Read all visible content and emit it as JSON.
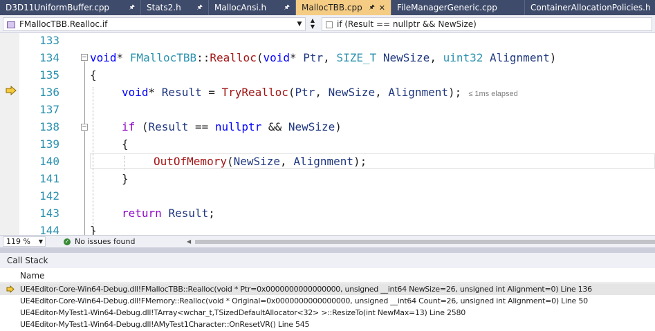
{
  "tabs": [
    {
      "label": "D3D11UniformBuffer.cpp",
      "pinned": true
    },
    {
      "label": "Stats2.h",
      "pinned": true
    },
    {
      "label": "MallocAnsi.h",
      "pinned": true
    },
    {
      "label": "MallocTBB.cpp",
      "pinned": true,
      "active": true,
      "close": "✕"
    },
    {
      "label": "FileManagerGeneric.cpp",
      "pinned": false
    },
    {
      "label": "ContainerAllocationPolicies.h",
      "pinned": false
    }
  ],
  "nav": {
    "left_scope": "FMallocTBB.Realloc.if",
    "right_scope": "if (Result == nullptr && NewSize)"
  },
  "editor": {
    "line_numbers": [
      "133",
      "134",
      "135",
      "136",
      "137",
      "138",
      "139",
      "140",
      "141",
      "142",
      "143",
      "144"
    ],
    "elapsed": "≤ 1ms elapsed"
  },
  "status": {
    "zoom": "119 %",
    "issues": "No issues found"
  },
  "callstack": {
    "title": "Call Stack",
    "column_name": "Name",
    "frames": [
      "UE4Editor-Core-Win64-Debug.dll!FMallocTBB::Realloc(void * Ptr=0x0000000000000000, unsigned __int64 NewSize=26, unsigned int Alignment=0) Line 136",
      "UE4Editor-Core-Win64-Debug.dll!FMemory::Realloc(void * Original=0x0000000000000000, unsigned __int64 Count=26, unsigned int Alignment=0) Line 50",
      "UE4Editor-MyTest1-Win64-Debug.dll!TArray<wchar_t,TSizedDefaultAllocator<32> >::ResizeTo(int NewMax=13) Line 2580",
      "UE4Editor-MyTest1-Win64-Debug.dll!AMyTest1Character::OnResetVR() Line 545"
    ]
  },
  "colors": {
    "tab_strip": "#3f4b6b",
    "active_tab": "#f5cc84",
    "keyword": "#0000ff",
    "control_keyword": "#8f08c4",
    "type": "#2b91af",
    "function": "#74531f",
    "parameter": "#1f377f"
  }
}
